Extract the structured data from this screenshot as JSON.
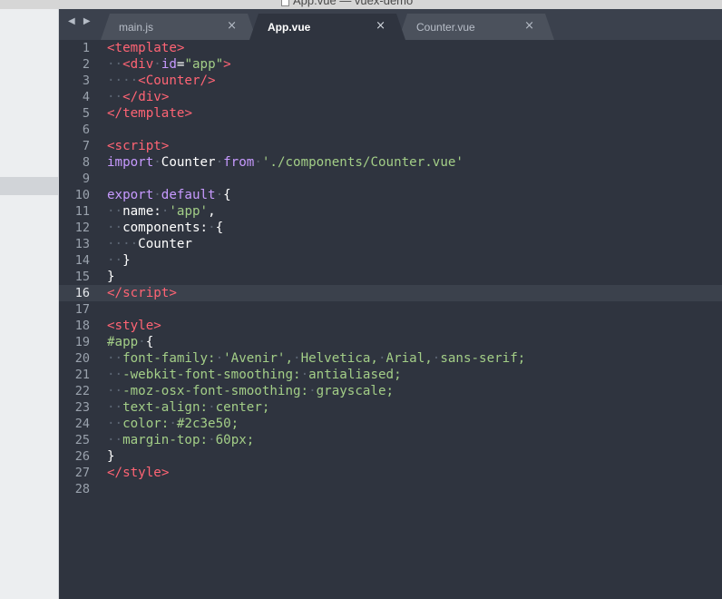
{
  "window": {
    "title": "App.vue — vuex-demo"
  },
  "icons": {
    "nav_back": "chevron-left-icon",
    "nav_forward": "chevron-right-icon",
    "close": "close-icon",
    "file": "document-icon"
  },
  "nav": {
    "arrows": "◀ ▶"
  },
  "tabs": [
    {
      "label": "main.js",
      "close": "×",
      "active": false
    },
    {
      "label": "App.vue",
      "close": "×",
      "active": true
    },
    {
      "label": "Counter.vue",
      "close": "×",
      "active": false
    }
  ],
  "colors": {
    "editor_bg": "#2f343f",
    "tag": "#ff6474",
    "keyword": "#c79aff",
    "string": "#a3ce87",
    "gutter": "#9aa2ad"
  },
  "editor": {
    "current_line": 16,
    "lines": [
      [
        [
          "<",
          "tag"
        ],
        [
          "template",
          "tag"
        ],
        [
          ">",
          "tag"
        ]
      ],
      [
        [
          "··",
          "ws"
        ],
        [
          "<",
          "tag"
        ],
        [
          "div",
          "tag"
        ],
        [
          "·",
          "ws"
        ],
        [
          "id",
          "attr"
        ],
        [
          "=",
          "punc"
        ],
        [
          "\"app\"",
          "str"
        ],
        [
          ">",
          "tag"
        ]
      ],
      [
        [
          "····",
          "ws"
        ],
        [
          "<",
          "tag"
        ],
        [
          "Counter",
          "tag"
        ],
        [
          "/>",
          "tag"
        ]
      ],
      [
        [
          "··",
          "ws"
        ],
        [
          "</",
          "tag"
        ],
        [
          "div",
          "tag"
        ],
        [
          ">",
          "tag"
        ]
      ],
      [
        [
          "</",
          "tag"
        ],
        [
          "template",
          "tag"
        ],
        [
          ">",
          "tag"
        ]
      ],
      [],
      [
        [
          "<",
          "tag"
        ],
        [
          "script",
          "tag"
        ],
        [
          ">",
          "tag"
        ]
      ],
      [
        [
          "import",
          "kw"
        ],
        [
          "·",
          "ws"
        ],
        [
          "Counter",
          "punc"
        ],
        [
          "·",
          "ws"
        ],
        [
          "from",
          "kw"
        ],
        [
          "·",
          "ws"
        ],
        [
          "'./components/Counter.vue'",
          "str"
        ]
      ],
      [],
      [
        [
          "export",
          "kw"
        ],
        [
          "·",
          "ws"
        ],
        [
          "default",
          "kw"
        ],
        [
          "·",
          "ws"
        ],
        [
          "{",
          "punc"
        ]
      ],
      [
        [
          "··",
          "ws"
        ],
        [
          "name:",
          "punc"
        ],
        [
          "·",
          "ws"
        ],
        [
          "'app'",
          "str"
        ],
        [
          ",",
          "punc"
        ]
      ],
      [
        [
          "··",
          "ws"
        ],
        [
          "components:",
          "punc"
        ],
        [
          "·",
          "ws"
        ],
        [
          "{",
          "punc"
        ]
      ],
      [
        [
          "····",
          "ws"
        ],
        [
          "Counter",
          "punc"
        ]
      ],
      [
        [
          "··",
          "ws"
        ],
        [
          "}",
          "punc"
        ]
      ],
      [
        [
          "}",
          "punc"
        ]
      ],
      [
        [
          "</",
          "tag"
        ],
        [
          "script",
          "tag"
        ],
        [
          ">",
          "tag"
        ]
      ],
      [],
      [
        [
          "<",
          "tag"
        ],
        [
          "style",
          "tag"
        ],
        [
          ">",
          "tag"
        ]
      ],
      [
        [
          "#app",
          "sel"
        ],
        [
          "·",
          "ws"
        ],
        [
          "{",
          "punc"
        ]
      ],
      [
        [
          "··",
          "ws"
        ],
        [
          "font-family:",
          "prop"
        ],
        [
          "·",
          "ws"
        ],
        [
          "'Avenir',",
          "val"
        ],
        [
          "·",
          "ws"
        ],
        [
          "Helvetica,",
          "val"
        ],
        [
          "·",
          "ws"
        ],
        [
          "Arial,",
          "val"
        ],
        [
          "·",
          "ws"
        ],
        [
          "sans-serif;",
          "val"
        ]
      ],
      [
        [
          "··",
          "ws"
        ],
        [
          "-webkit-font-smoothing:",
          "prop"
        ],
        [
          "·",
          "ws"
        ],
        [
          "antialiased;",
          "val"
        ]
      ],
      [
        [
          "··",
          "ws"
        ],
        [
          "-moz-osx-font-smoothing:",
          "prop"
        ],
        [
          "·",
          "ws"
        ],
        [
          "grayscale;",
          "val"
        ]
      ],
      [
        [
          "··",
          "ws"
        ],
        [
          "text-align:",
          "prop"
        ],
        [
          "·",
          "ws"
        ],
        [
          "center;",
          "val"
        ]
      ],
      [
        [
          "··",
          "ws"
        ],
        [
          "color:",
          "prop"
        ],
        [
          "·",
          "ws"
        ],
        [
          "#2c3e50;",
          "val"
        ]
      ],
      [
        [
          "··",
          "ws"
        ],
        [
          "margin-top:",
          "prop"
        ],
        [
          "·",
          "ws"
        ],
        [
          "60px;",
          "val"
        ]
      ],
      [
        [
          "}",
          "punc"
        ]
      ],
      [
        [
          "</",
          "tag"
        ],
        [
          "style",
          "tag"
        ],
        [
          ">",
          "tag"
        ]
      ],
      []
    ]
  }
}
